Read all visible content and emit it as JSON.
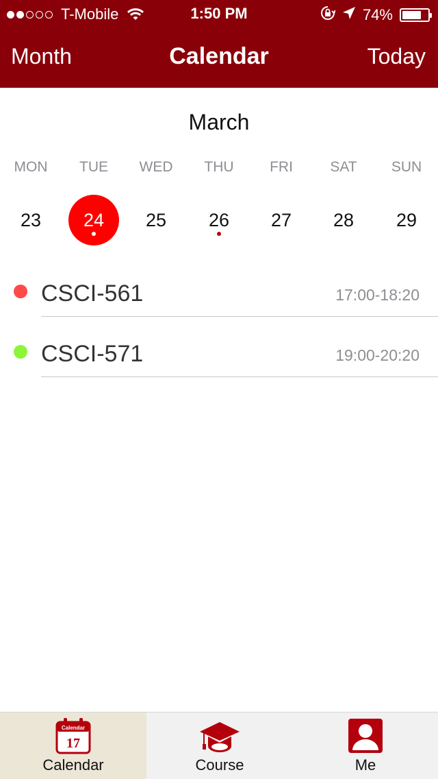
{
  "status_bar": {
    "carrier": "T-Mobile",
    "signal_bars_filled": 2,
    "signal_bars_total": 5,
    "time": "1:50 PM",
    "battery_percent": "74%",
    "battery_level": 0.74
  },
  "nav": {
    "left_label": "Month",
    "title": "Calendar",
    "right_label": "Today"
  },
  "calendar": {
    "month": "March",
    "weekdays": [
      "MON",
      "TUE",
      "WED",
      "THU",
      "FRI",
      "SAT",
      "SUN"
    ],
    "days": [
      {
        "label": "23",
        "selected": false,
        "has_event": false
      },
      {
        "label": "24",
        "selected": true,
        "has_event": true
      },
      {
        "label": "25",
        "selected": false,
        "has_event": false
      },
      {
        "label": "26",
        "selected": false,
        "has_event": true
      },
      {
        "label": "27",
        "selected": false,
        "has_event": false
      },
      {
        "label": "28",
        "selected": false,
        "has_event": false
      },
      {
        "label": "29",
        "selected": false,
        "has_event": false
      }
    ]
  },
  "events": [
    {
      "name": "CSCI-561",
      "time": "17:00-18:20",
      "color": "#ff4a4a"
    },
    {
      "name": "CSCI-571",
      "time": "19:00-20:20",
      "color": "#8cf53a"
    }
  ],
  "tabs": [
    {
      "label": "Calendar",
      "icon": "calendar-icon",
      "icon_text": "17",
      "icon_caption": "Calendar",
      "active": true
    },
    {
      "label": "Course",
      "icon": "graduation-cap-icon",
      "active": false
    },
    {
      "label": "Me",
      "icon": "user-icon",
      "active": false
    }
  ],
  "colors": {
    "brand": "#8a0009",
    "selected_day": "#ff0000",
    "event_dot_on_selected": "#ffffff",
    "event_dot": "#b8000e",
    "tab_active_bg": "#ece6d6",
    "tab_icon": "#b3000c"
  }
}
